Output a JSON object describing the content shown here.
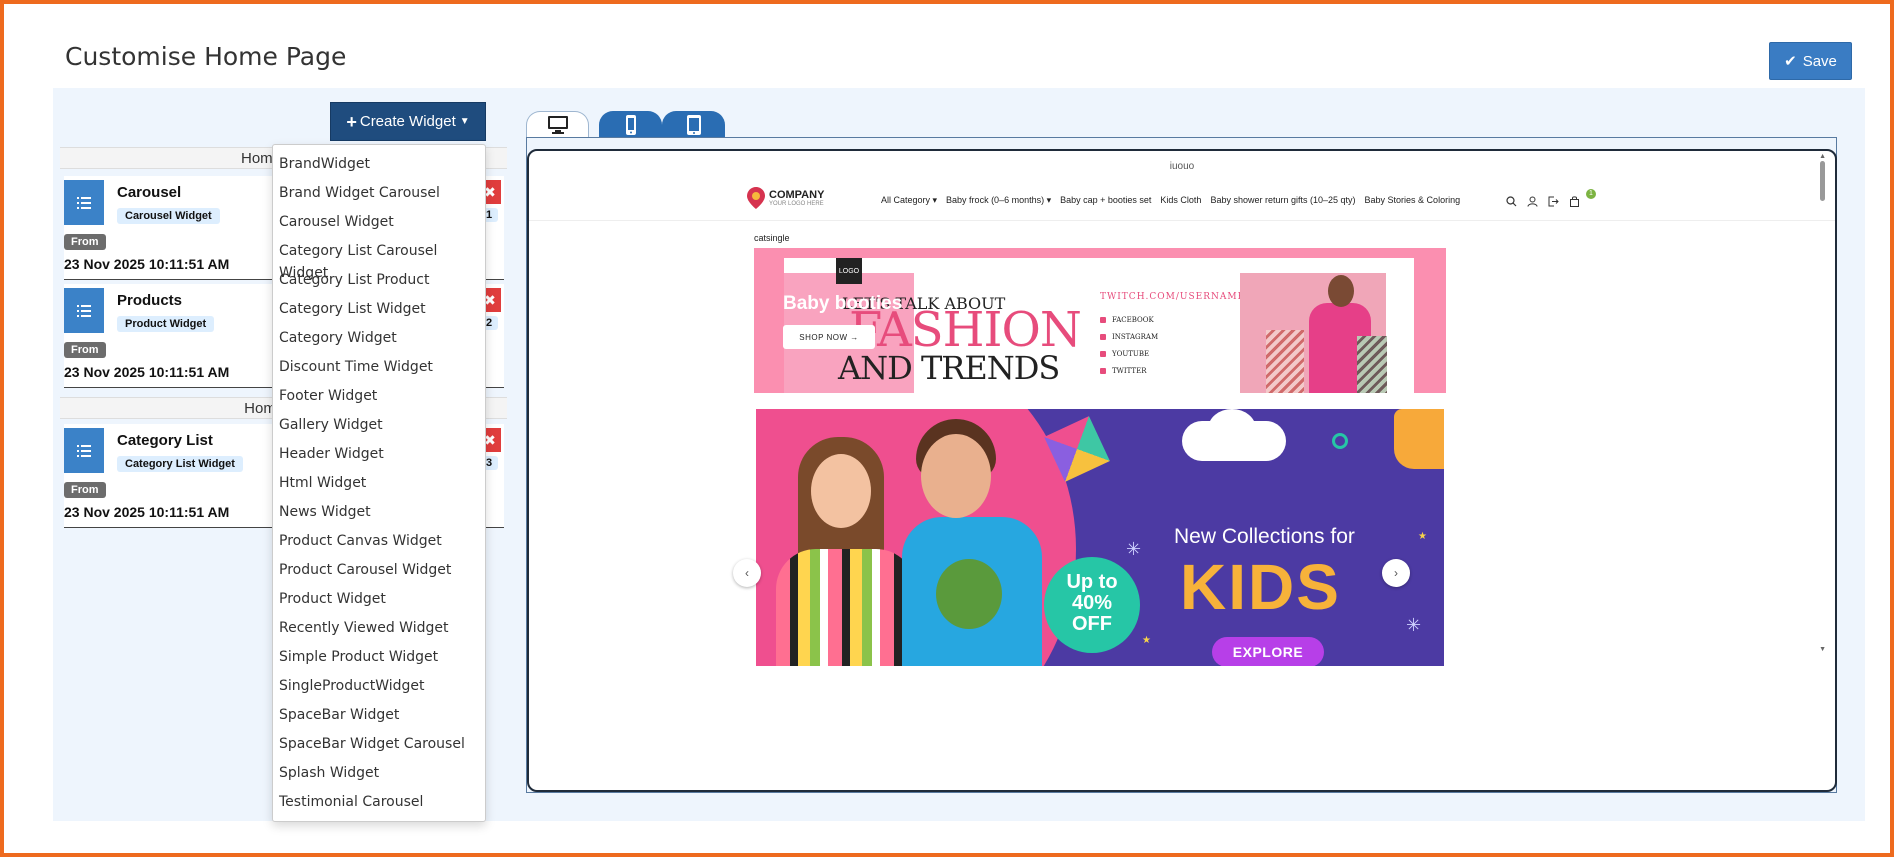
{
  "page": {
    "title": "Customise Home Page",
    "save_label": "Save"
  },
  "toolbar": {
    "create_widget_label": "Create Widget"
  },
  "sections": [
    {
      "title": "Home"
    },
    {
      "title": "Home M"
    }
  ],
  "widgets": [
    {
      "title": "Carousel",
      "type": "Carousel Widget",
      "from_label": "From",
      "date": "23 Nov 2025 10:11:51 AM",
      "position": "1"
    },
    {
      "title": "Products",
      "type": "Product Widget",
      "from_label": "From",
      "date": "23 Nov 2025 10:11:51 AM",
      "position": "2"
    },
    {
      "title": "Category List",
      "type": "Category List Widget",
      "from_label": "From",
      "date": "23 Nov 2025 10:11:51 AM",
      "position": "3"
    }
  ],
  "dropdown_items": [
    "BrandWidget",
    "Brand Widget Carousel",
    "Carousel Widget",
    "Category List Carousel Widget",
    "Category List Product",
    "Category List Widget",
    "Category Widget",
    "Discount Time Widget",
    "Footer Widget",
    "Gallery Widget",
    "Header Widget",
    "Html Widget",
    "News Widget",
    "Product Canvas Widget",
    "Product Carousel Widget",
    "Product Widget",
    "Recently Viewed Widget",
    "Simple Product Widget",
    "SingleProductWidget",
    "SpaceBar Widget",
    "SpaceBar Widget Carousel",
    "Splash Widget",
    "Testimonial Carousel"
  ],
  "device_tabs": [
    {
      "icon": "desktop-icon",
      "active": true
    },
    {
      "icon": "mobile-icon",
      "active": false
    },
    {
      "icon": "tablet-icon",
      "active": false
    }
  ],
  "preview": {
    "top_text": "iuouo",
    "logo_title": "COMPANY",
    "logo_sub": "YOUR LOGO HERE",
    "menu": [
      "All Category ▾",
      "Baby frock (0–6 months) ▾",
      "Baby cap + booties set",
      "Kids Cloth",
      "Baby shower return gifts (10–25 qty)",
      "Baby Stories & Coloring"
    ],
    "cart_count": "1",
    "section_label": "catsingle",
    "banner1": {
      "logo": "LOGO",
      "headline_small": "LET'S TALK ABOUT",
      "fashion": "FASHION",
      "trends": "AND TRENDS",
      "overlay_title": "Baby booties",
      "shop_now": "SHOP NOW →",
      "twitch": "TWITCH.COM/USERNAME",
      "social": [
        "FACEBOOK",
        "INSTAGRAM",
        "YOUTUBE",
        "TWITTER"
      ]
    },
    "banner2": {
      "offer_line1": "Up to",
      "offer_line2": "40%",
      "offer_line3": "OFF",
      "new_collections": "New Collections for",
      "kids": "KIDS",
      "explore": "EXPLORE"
    }
  },
  "colors": {
    "frame_border": "#ee6a1e",
    "save_button": "#3a7cc3",
    "create_button": "#1f4c7e",
    "workspace_bg": "#eef5fd",
    "delete_button": "#e03d3d",
    "widget_icon": "#3b82c8"
  }
}
